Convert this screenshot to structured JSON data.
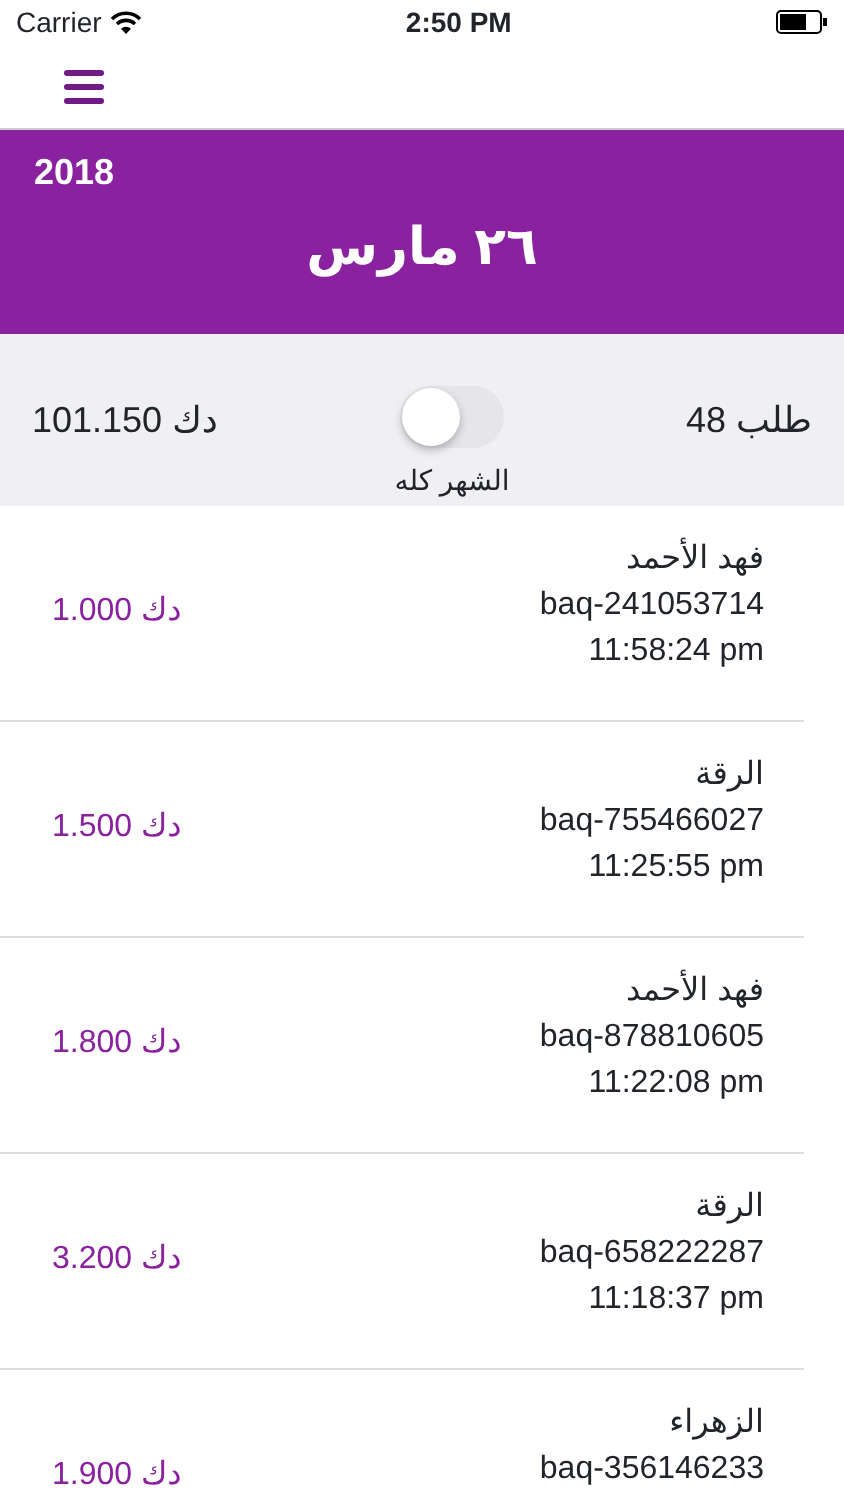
{
  "status_bar": {
    "carrier": "Carrier",
    "time": "2:50 PM"
  },
  "header": {
    "year": "2018",
    "date": "٢٦ مارس"
  },
  "summary": {
    "total": "101.150 دك",
    "toggle": {
      "on": false,
      "label": "الشهر كله"
    },
    "count": "48 طلب"
  },
  "orders": [
    {
      "name": "فهد الأحمد",
      "id": "baq-241053714",
      "time": "11:58:24 pm",
      "amount": "1.000 دك"
    },
    {
      "name": "الرقة",
      "id": "baq-755466027",
      "time": "11:25:55 pm",
      "amount": "1.500 دك"
    },
    {
      "name": "فهد الأحمد",
      "id": "baq-878810605",
      "time": "11:22:08 pm",
      "amount": "1.800 دك"
    },
    {
      "name": "الرقة",
      "id": "baq-658222287",
      "time": "11:18:37 pm",
      "amount": "3.200 دك"
    },
    {
      "name": "الزهراء",
      "id": "baq-356146233",
      "amount": "1.900 دك"
    }
  ]
}
